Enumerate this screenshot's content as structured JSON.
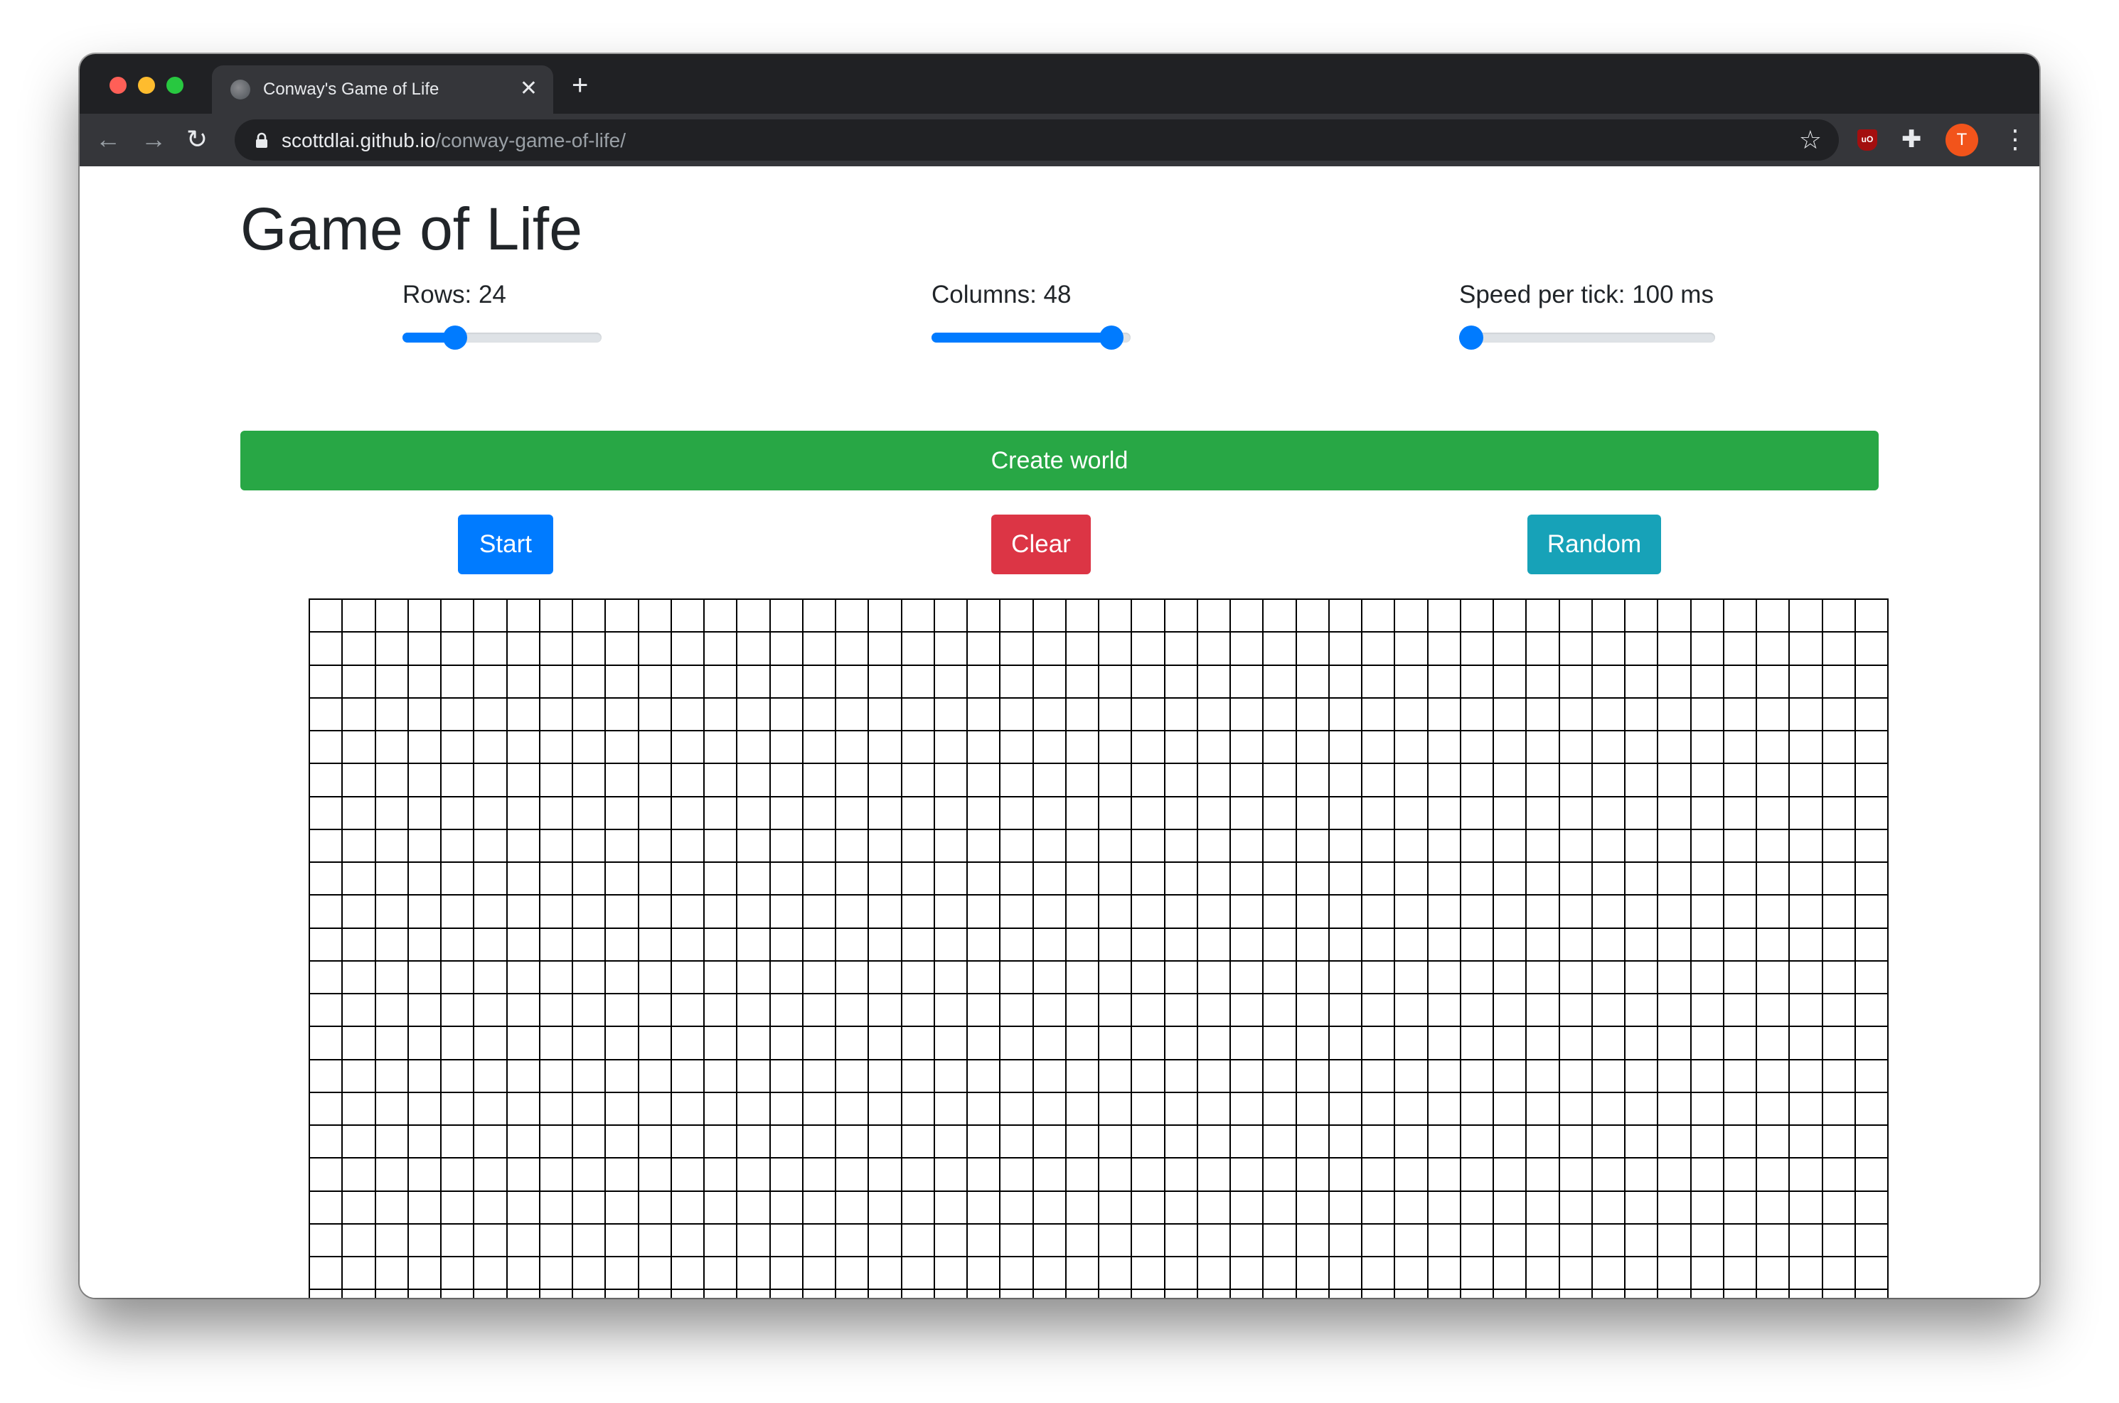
{
  "browser": {
    "tab_title": "Conway's Game of Life",
    "new_tab_label": "+",
    "url_host": "scottdlai.github.io",
    "url_path": "/conway-game-of-life/",
    "avatar_letter": "T",
    "ublock_label": "uO"
  },
  "page": {
    "title": "Game of Life",
    "rows": {
      "label": "Rows: 24",
      "value": 24,
      "min": 1,
      "max": 100
    },
    "columns": {
      "label": "Columns: 48",
      "value": 48,
      "min": 1,
      "max": 50
    },
    "speed": {
      "label": "Speed per tick: 100 ms",
      "value": 100,
      "min": 100,
      "max": 2000
    },
    "create_button": "Create world",
    "start_button": "Start",
    "clear_button": "Clear",
    "random_button": "Random"
  },
  "grid": {
    "rows": 24,
    "cols": 48,
    "alive_cells": []
  },
  "colors": {
    "primary": "#007bff",
    "success": "#28a745",
    "danger": "#dc3545",
    "info": "#17a2b8",
    "text": "#212529"
  }
}
